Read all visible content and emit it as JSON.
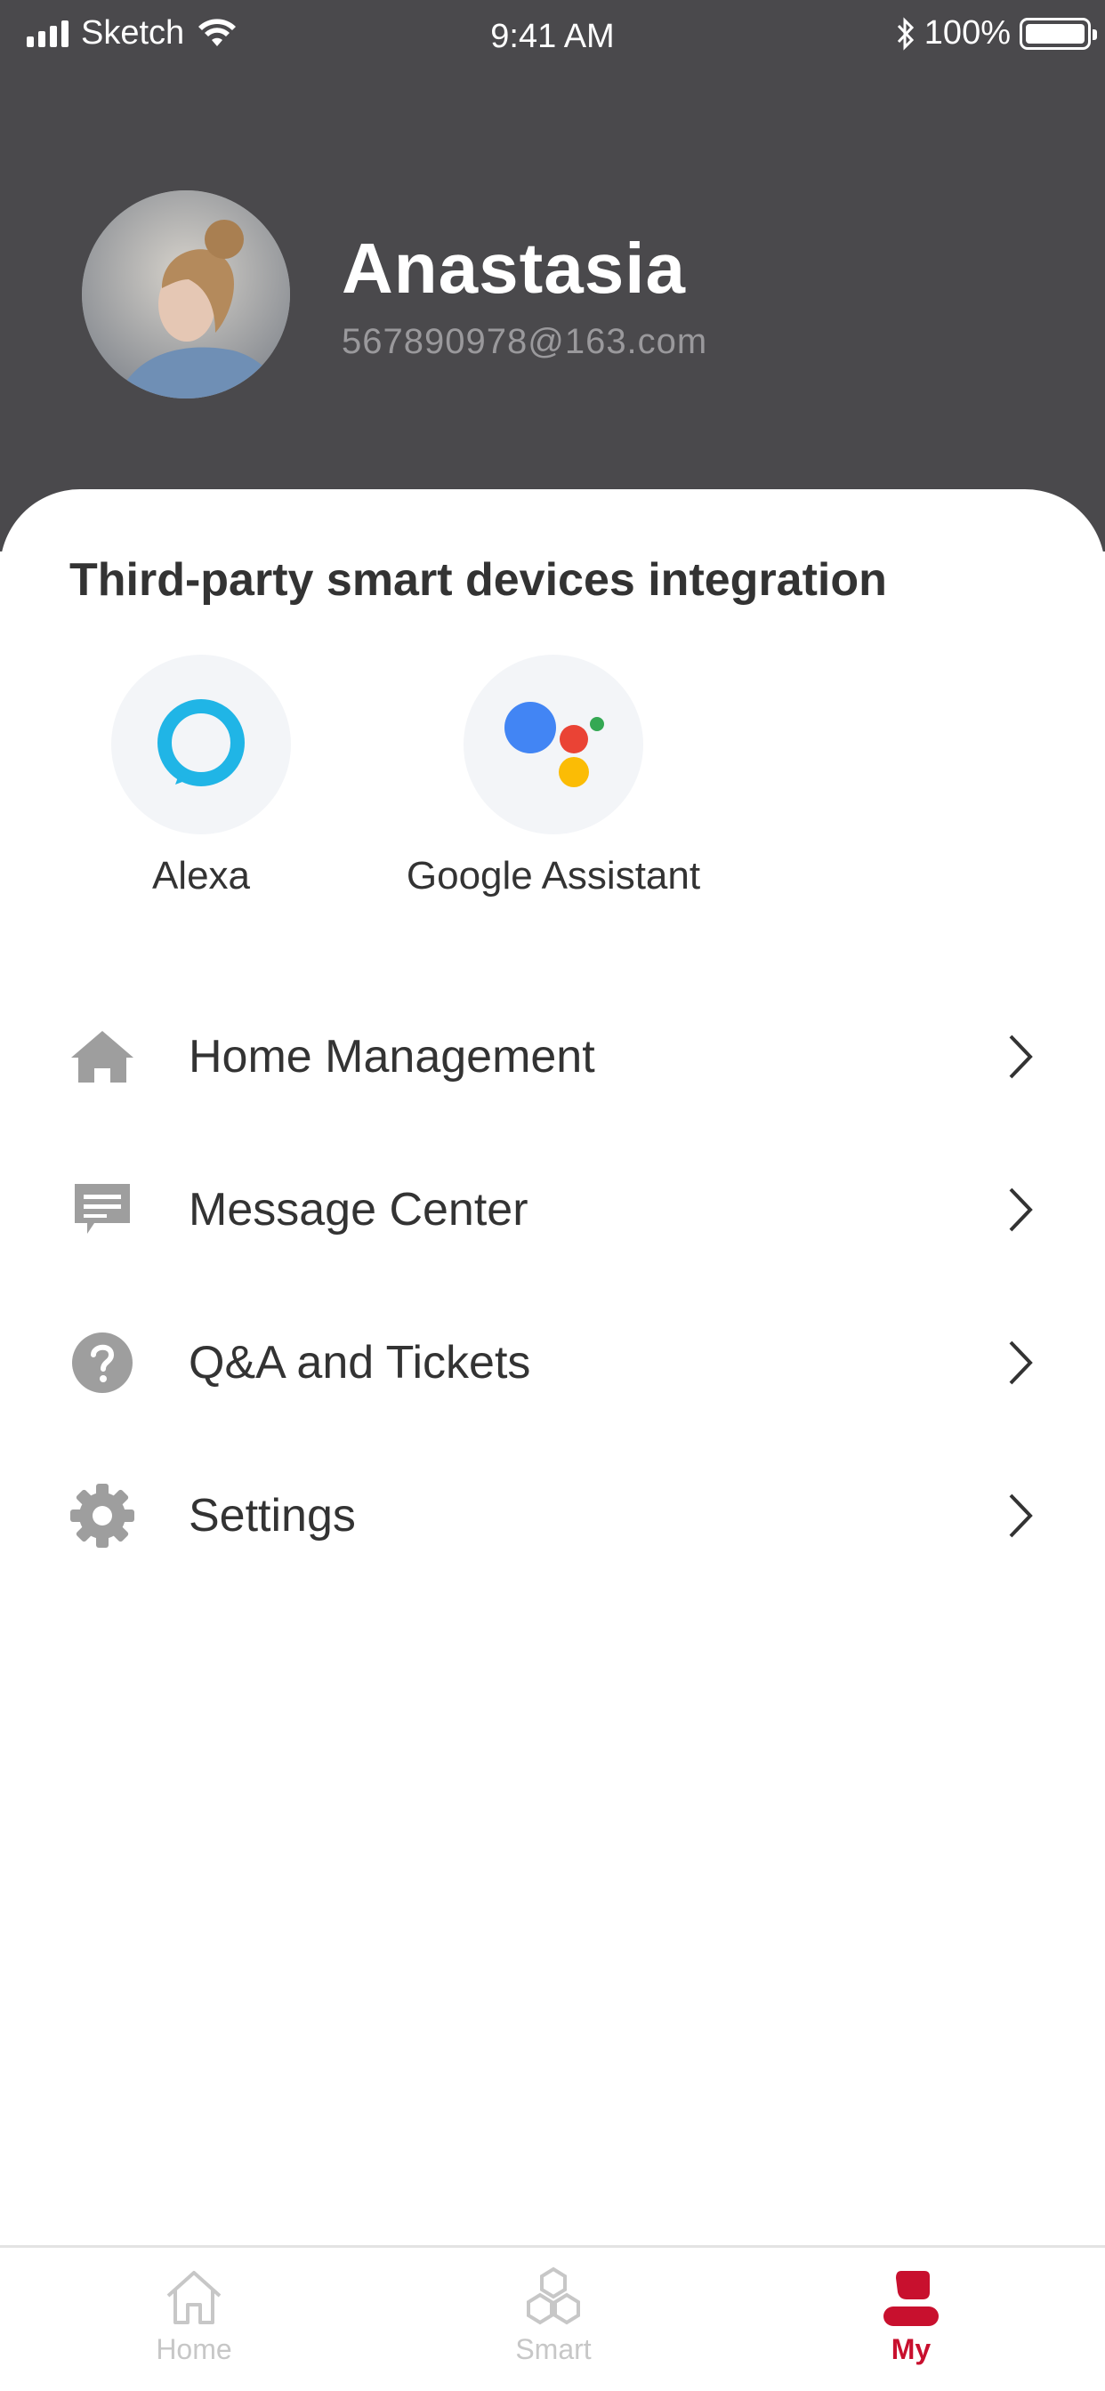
{
  "status_bar": {
    "carrier": "Sketch",
    "time": "9:41 AM",
    "battery": "100%"
  },
  "profile": {
    "name": "Anastasia",
    "email": "567890978@163.com"
  },
  "integration": {
    "title": "Third-party smart devices integration",
    "items": [
      {
        "label": "Alexa",
        "icon": "alexa-icon"
      },
      {
        "label": "Google Assistant",
        "icon": "google-assistant-icon"
      }
    ]
  },
  "menu": {
    "items": [
      {
        "label": "Home Management",
        "icon": "home-icon"
      },
      {
        "label": "Message Center",
        "icon": "message-icon"
      },
      {
        "label": "Q&A and Tickets",
        "icon": "question-icon"
      },
      {
        "label": "Settings",
        "icon": "gear-icon"
      }
    ]
  },
  "tabbar": {
    "items": [
      {
        "label": "Home",
        "icon": "home-outline-icon",
        "active": false
      },
      {
        "label": "Smart",
        "icon": "hexagons-icon",
        "active": false
      },
      {
        "label": "My",
        "icon": "person-icon",
        "active": true
      }
    ]
  },
  "colors": {
    "header_bg": "#4a494c",
    "accent": "#c8102e",
    "icon_gray": "#9e9e9e",
    "inactive_tab": "#c7c7c7"
  }
}
